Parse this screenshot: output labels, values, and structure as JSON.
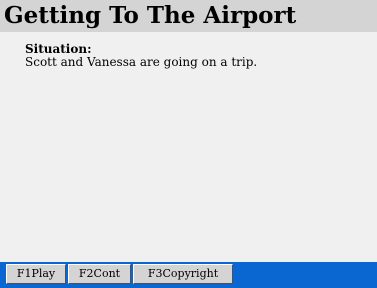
{
  "title": "Getting To The Airport",
  "situation": {
    "label": "Situation:",
    "text": "Scott and Vanessa are going on a trip."
  },
  "function_keys": [
    {
      "label": "F1Play"
    },
    {
      "label": "F2Cont"
    },
    {
      "label": "F3Copyright"
    }
  ],
  "colors": {
    "title_bar": "#d4d4d4",
    "content_bg": "#f0f0f0",
    "fkey_bar": "#0a67d2",
    "fkey_button": "#d4d4d4"
  }
}
